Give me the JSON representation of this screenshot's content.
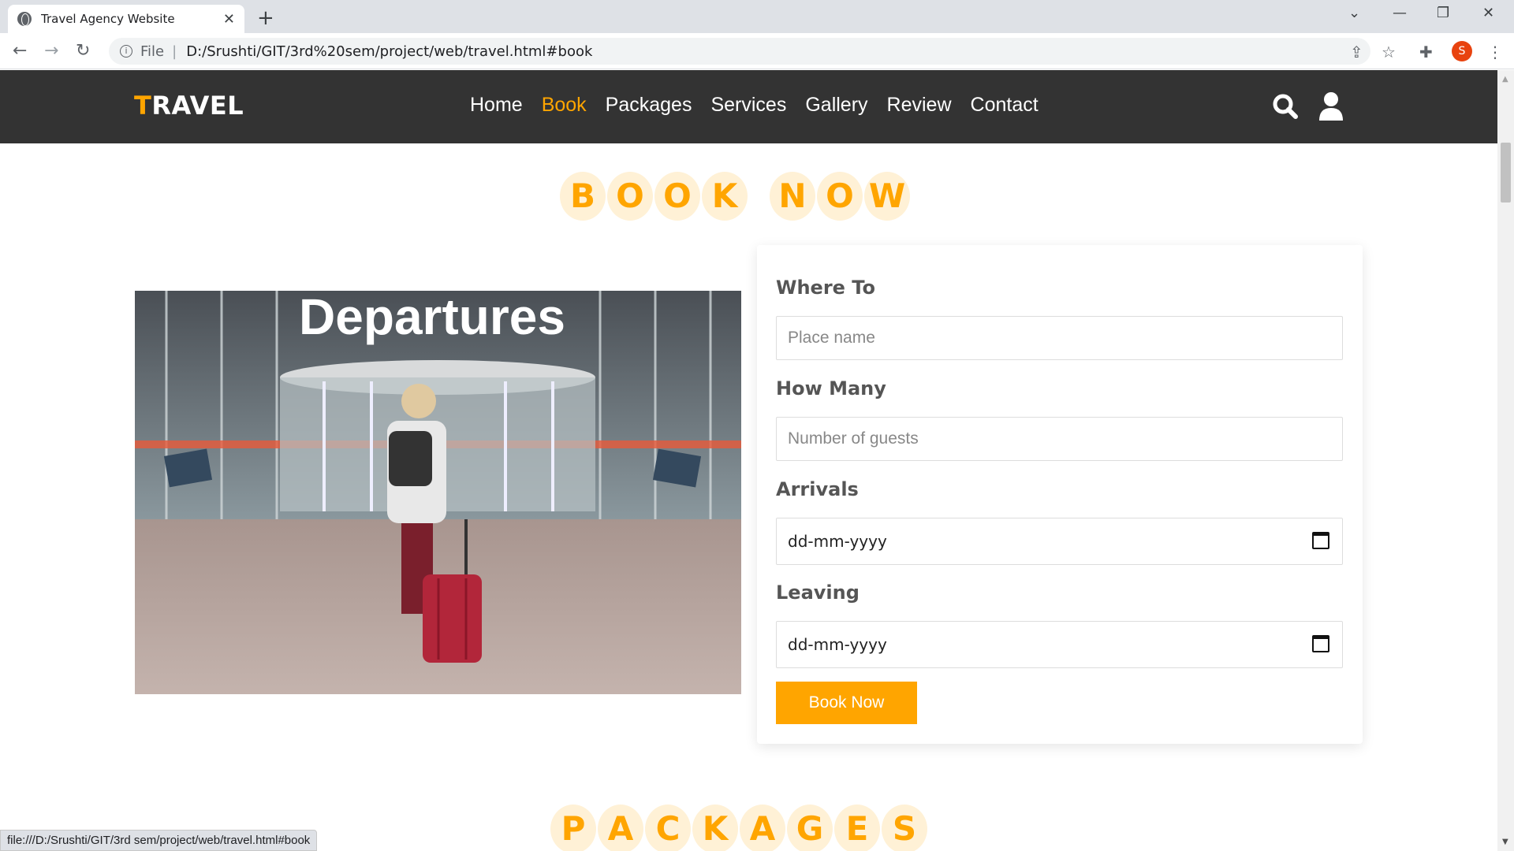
{
  "browser": {
    "tab_title": "Travel Agency Website",
    "tab_close": "✕",
    "new_tab": "+",
    "url_scheme_label": "File",
    "url": "D:/Srushti/GIT/3rd%20sem/project/web/travel.html#book",
    "profile_initial": "S",
    "status_url": "file:///D:/Srushti/GIT/3rd sem/project/web/travel.html#book"
  },
  "site": {
    "logo_first": "T",
    "logo_rest": "RAVEL",
    "nav": [
      "Home",
      "Book",
      "Packages",
      "Services",
      "Gallery",
      "Review",
      "Contact"
    ],
    "active_nav": "Book"
  },
  "book": {
    "heading_word1": [
      "B",
      "O",
      "O",
      "K"
    ],
    "heading_word2": [
      "N",
      "O",
      "W"
    ],
    "image_sign": "Departures",
    "form": {
      "where_label": "Where To",
      "where_placeholder": "Place name",
      "how_label": "How Many",
      "how_placeholder": "Number of guests",
      "arrivals_label": "Arrivals",
      "arrivals_value": "dd-mm-yyyy",
      "leaving_label": "Leaving",
      "leaving_value": "dd-mm-yyyy",
      "button": "Book Now"
    }
  },
  "packages": {
    "heading": [
      "P",
      "A",
      "C",
      "K",
      "A",
      "G",
      "E",
      "S"
    ]
  },
  "colors": {
    "accent": "#ffa500",
    "header_bg": "#333333",
    "circle_bg": "#fff1d6"
  }
}
